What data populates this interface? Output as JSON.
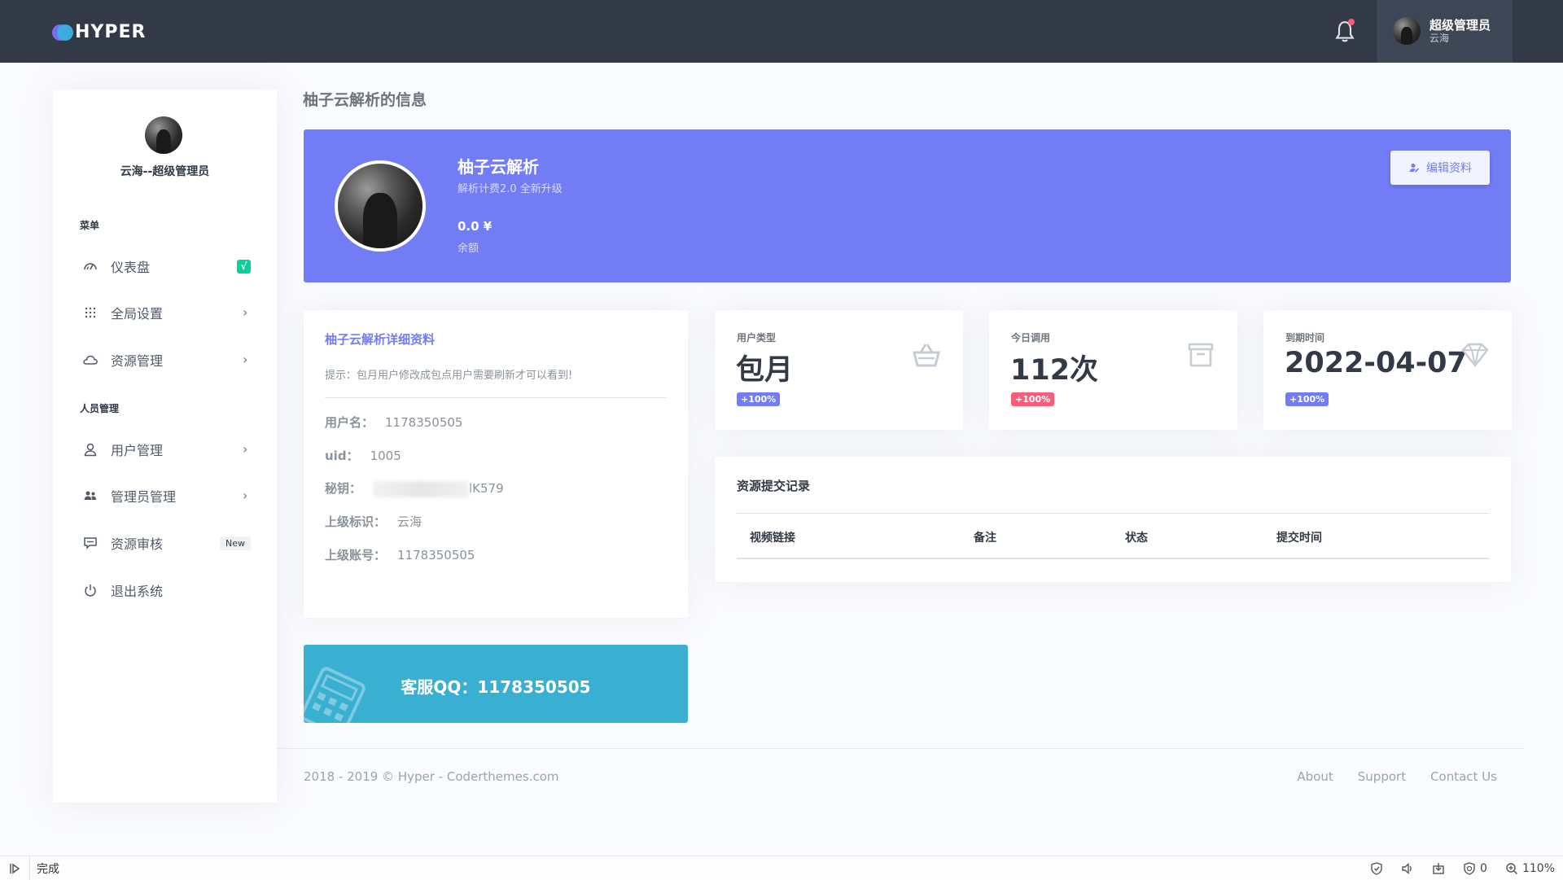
{
  "topbar": {
    "logo_text": "HYPER",
    "user_name": "超级管理员",
    "user_sub": "云海"
  },
  "sidebar": {
    "profile_name": "云海--超级管理员",
    "section_menu": "菜单",
    "section_people": "人员管理",
    "items": [
      {
        "label": "仪表盘",
        "icon": "speedometer-icon",
        "badge": "√"
      },
      {
        "label": "全局设置",
        "icon": "grid-icon"
      },
      {
        "label": "资源管理",
        "icon": "cloud-icon"
      },
      {
        "label": "用户管理",
        "icon": "user-icon"
      },
      {
        "label": "管理员管理",
        "icon": "users-icon"
      },
      {
        "label": "资源审核",
        "icon": "message-icon",
        "badge": "New"
      },
      {
        "label": "退出系统",
        "icon": "power-icon"
      }
    ]
  },
  "page_title": "柚子云解析的信息",
  "banner": {
    "title": "柚子云解析",
    "subtitle": "解析计费2.0 全新升级",
    "balance": "0.0 ¥",
    "balance_label": "余额",
    "edit_button": "编辑资料"
  },
  "details": {
    "title": "柚子云解析详细资料",
    "tip": "提示：包月用户修改成包点用户需要刷新才可以看到!",
    "rows": [
      {
        "label": "用户名：",
        "value": "1178350505"
      },
      {
        "label": "uid：",
        "value": "1005"
      },
      {
        "label": "秘钥：",
        "value": "lK579"
      },
      {
        "label": "上级标识：",
        "value": "云海"
      },
      {
        "label": "上级账号：",
        "value": "1178350505"
      }
    ]
  },
  "stats": [
    {
      "label": "用户类型",
      "value": "包月",
      "badge": "+100%",
      "badge_color": "#727cf5",
      "icon": "basket-icon"
    },
    {
      "label": "今日调用",
      "value": "112次",
      "badge": "+100%",
      "badge_color": "#fa5c7c",
      "icon": "archive-icon"
    },
    {
      "label": "到期时间",
      "value": "2022-04-07",
      "badge": "+100%",
      "badge_color": "#727cf5",
      "icon": "diamond-icon"
    }
  ],
  "records": {
    "title": "资源提交记录",
    "columns": [
      "视频链接",
      "备注",
      "状态",
      "提交时间"
    ]
  },
  "qq": {
    "text": "客服QQ：1178350505"
  },
  "footer": {
    "copyright": "2018 - 2019 © Hyper - Coderthemes.com",
    "links": [
      "About",
      "Support",
      "Contact Us"
    ]
  },
  "statusbar": {
    "status": "完成",
    "count": "0",
    "zoom": "110%"
  },
  "colors": {
    "topbar": "#313a46",
    "primary": "#727cf5",
    "info": "#39afd1",
    "success": "#0acf97",
    "danger": "#fa5c7c"
  }
}
